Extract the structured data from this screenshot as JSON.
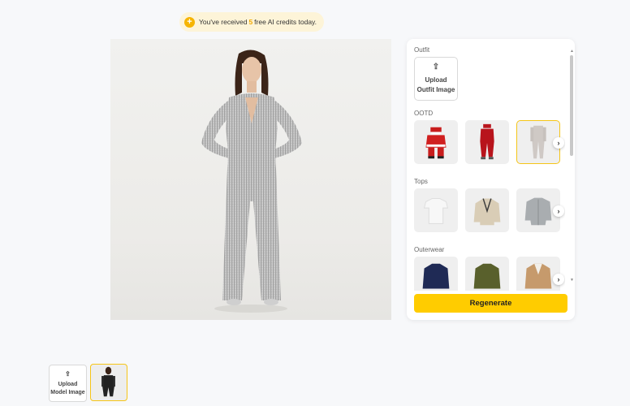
{
  "banner": {
    "prefix": "You've received",
    "count": "5",
    "suffix": "free AI credits today.",
    "icon": "plus-circle-icon"
  },
  "panel": {
    "outfit_title": "Outfit",
    "upload_icon": "upload-icon",
    "upload_outfit_label_1": "Upload",
    "upload_outfit_label_2": "Outfit Image",
    "sections": [
      {
        "title": "OOTD",
        "items": [
          "santa-suit",
          "red-holiday-jumpsuit",
          "silver-sequin-jumpsuit"
        ],
        "selected": 2
      },
      {
        "title": "Tops",
        "items": [
          "white-tshirt",
          "beige-cardigan",
          "grey-shirt"
        ],
        "selected": -1
      },
      {
        "title": "Outerwear",
        "items": [
          "navy-jacket",
          "olive-jacket",
          "camel-blazer"
        ],
        "selected": -1
      }
    ],
    "next_icon": "chevron-right-icon",
    "regenerate_label": "Regenerate"
  },
  "models": {
    "upload_label_1": "Upload",
    "upload_label_2": "Model Image"
  },
  "colors": {
    "accent": "#ffcc00",
    "highlight": "#f5c518",
    "banner_bg": "#fdf4d8"
  }
}
